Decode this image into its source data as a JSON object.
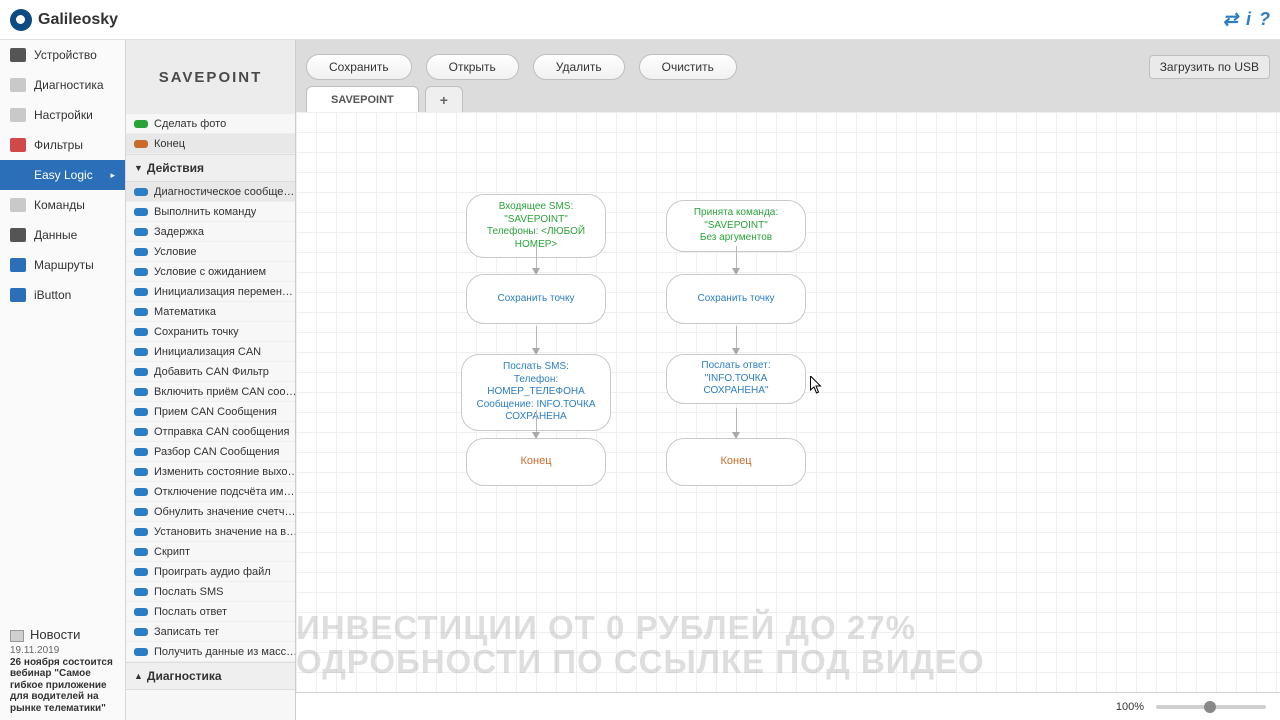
{
  "brand": "Galileosky",
  "sidebar": {
    "items": [
      {
        "label": "Устройство",
        "icon": "#555"
      },
      {
        "label": "Диагностика",
        "icon": "#c9c9c9"
      },
      {
        "label": "Настройки",
        "icon": "#c9c9c9"
      },
      {
        "label": "Фильтры",
        "icon": "#d04848"
      },
      {
        "label": "Easy Logic",
        "icon": "#2b6fb8",
        "active": true
      },
      {
        "label": "Команды",
        "icon": "#c9c9c9"
      },
      {
        "label": "Данные",
        "icon": "#555"
      },
      {
        "label": "Маршруты",
        "icon": "#2b6fb8"
      },
      {
        "label": "iButton",
        "icon": "#2b6fb8"
      }
    ],
    "news": {
      "header": "Новости",
      "date": "19.11.2019",
      "title": "26 ноября состоится вебинар \"Самое гибкое приложение для водителей на рынке телематики\""
    }
  },
  "palette": {
    "title": "SAVEPOINT",
    "pre_rows": [
      {
        "label": "Сделать фото",
        "color": "#2aa33a"
      },
      {
        "label": "Конец",
        "color": "#c96b2b",
        "sel": true
      }
    ],
    "section_actions": "Действия",
    "rows": [
      "Диагностическое сообще…",
      "Выполнить команду",
      "Задержка",
      "Условие",
      "Условие с ожиданием",
      "Инициализация перемен…",
      "Математика",
      "Сохранить точку",
      "Инициализация CAN",
      "Добавить CAN Фильтр",
      "Включить приём CAN соо…",
      "Прием CAN Сообщения",
      "Отправка CAN сообщения",
      "Разбор CAN Сообщения",
      "Изменить состояние выхо…",
      "Отключение подсчёта им…",
      "Обнулить значение счетч…",
      "Установить значение на в…",
      "Скрипт",
      "Проиграть аудио файл",
      "Послать SMS",
      "Послать ответ",
      "Записать тег",
      "Получить данные из масс…"
    ],
    "row_color": "#2c7ec4",
    "section_diag": "Диагностика"
  },
  "toolbar": {
    "save": "Сохранить",
    "open": "Открыть",
    "delete": "Удалить",
    "clear": "Очистить",
    "usb": "Загрузить по USB"
  },
  "tabs": {
    "main": "SAVEPOINT",
    "add": "+"
  },
  "canvas": {
    "left": {
      "start": "Входящее SMS:\n\"SAVEPOINT\"\nТелефоны: <ЛЮБОЙ\nНОМЕР>",
      "save": "Сохранить точку",
      "send": "Послать SMS:\nТелефон: НОМЕР_ТЕЛЕФОНА\nСообщение: INFO.ТОЧКА\nСОХРАНЕНА",
      "end": "Конец"
    },
    "right": {
      "start": "Принята команда:\n\"SAVEPOINT\"\nБез аргументов",
      "save": "Сохранить точку",
      "send": "Послать ответ:\n\"INFO.ТОЧКА\nСОХРАНЕНА\"",
      "end": "Конец"
    }
  },
  "watermark": {
    "line1": "ИНВЕСТИЦИИ ОТ 0 РУБЛЕЙ ДО 27%",
    "line2": "ОДРОБНОСТИ ПО ССЫЛКЕ ПОД ВИДЕО"
  },
  "footer": {
    "zoom": "100%"
  }
}
